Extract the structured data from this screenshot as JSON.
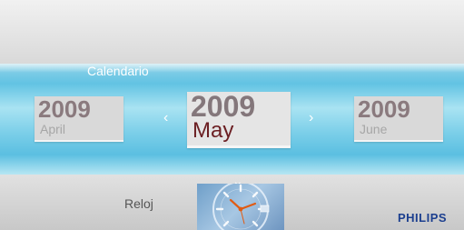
{
  "section": {
    "label": "Calendario"
  },
  "calendar": {
    "prev": {
      "year": "2009",
      "month": "April"
    },
    "current": {
      "year": "2009",
      "month": "May"
    },
    "next": {
      "year": "2009",
      "month": "June"
    },
    "prev_arrow": "‹",
    "next_arrow": "›"
  },
  "clock": {
    "label": "Reloj",
    "icon": "clock-thumbnail-icon"
  },
  "chevron": {
    "symbol": "⌄",
    "icon": "chevron-down-icon"
  },
  "brand": {
    "text": "PHILIPS",
    "color": "#1c3f8f"
  },
  "colors": {
    "band": "#62c3e3",
    "current_month": "#6b1e22"
  }
}
